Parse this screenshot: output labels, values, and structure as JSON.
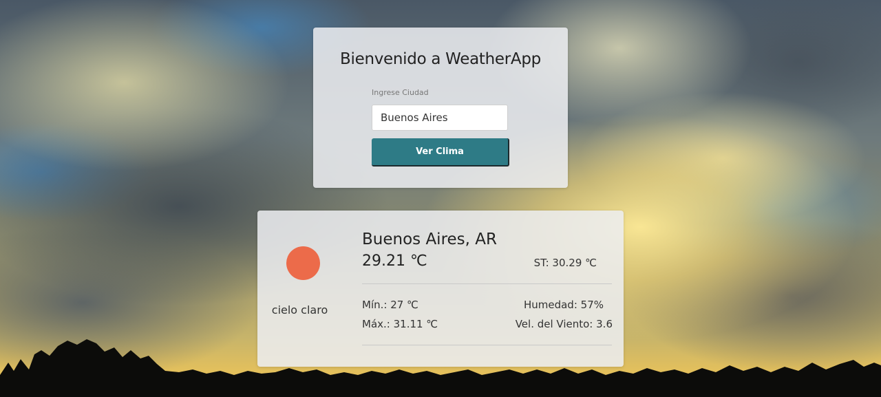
{
  "search": {
    "title": "Bienvenido a WeatherApp",
    "label": "Ingrese Ciudad",
    "value": "Buenos Aires",
    "button_label": "Ver Clima"
  },
  "weather": {
    "icon": "sun-icon",
    "icon_color": "#ec6b4a",
    "description": "cielo claro",
    "city": "Buenos Aires, AR",
    "temperature": "29.21 ℃",
    "feels_like": "ST: 30.29 ℃",
    "min": "Mín.: 27 ℃",
    "max": "Máx.: 31.11 ℃",
    "humidity": "Humedad: 57%",
    "wind": "Vel. del Viento: 3.6"
  },
  "colors": {
    "button": "#2e7b86",
    "card": "rgba(236,238,241,0.86)"
  }
}
